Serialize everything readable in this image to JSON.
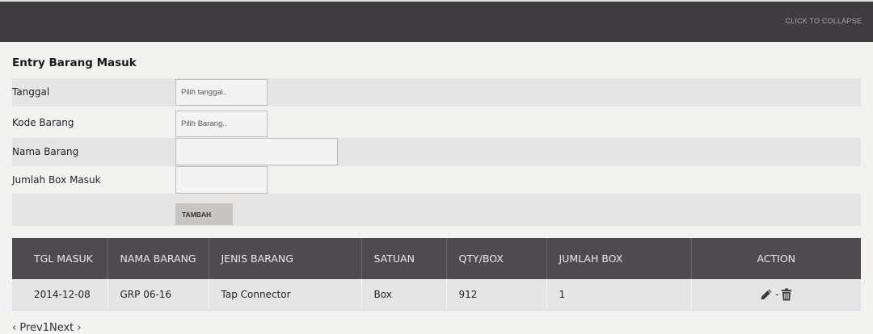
{
  "topbar": {
    "collapse_label": "CLICK TO COLLAPSE"
  },
  "form": {
    "title": "Entry Barang Masuk",
    "fields": {
      "tanggal": {
        "label": "Tanggal",
        "placeholder": "Pilih tanggal..",
        "value": ""
      },
      "kode_barang": {
        "label": "Kode Barang",
        "placeholder": "Pilih Barang..",
        "value": ""
      },
      "nama_barang": {
        "label": "Nama Barang",
        "value": ""
      },
      "jumlah_box": {
        "label": "Jumlah Box Masuk",
        "value": ""
      }
    },
    "submit_label": "TAMBAH"
  },
  "table": {
    "headers": [
      "TGL MASUK",
      "NAMA BARANG",
      "JENIS BARANG",
      "SATUAN",
      "QTY/BOX",
      "JUMLAH BOX",
      "ACTION"
    ],
    "rows": [
      {
        "tgl_masuk": "2014-12-08",
        "nama_barang": "GRP 06-16",
        "jenis_barang": "Tap Connector",
        "satuan": "Box",
        "qty_box": "912",
        "jumlah_box": "1",
        "action_separator": "-"
      }
    ]
  },
  "pager": {
    "prev": "‹ Prev",
    "page": "1",
    "next": "Next ›"
  },
  "icons": {
    "edit": "pencil-icon",
    "delete": "trash-icon"
  },
  "colors": {
    "topbar": "#3f3c40",
    "table_header": "#4e4a50",
    "row_shade": "#e6e5e6",
    "button": "#c9c5c3"
  }
}
